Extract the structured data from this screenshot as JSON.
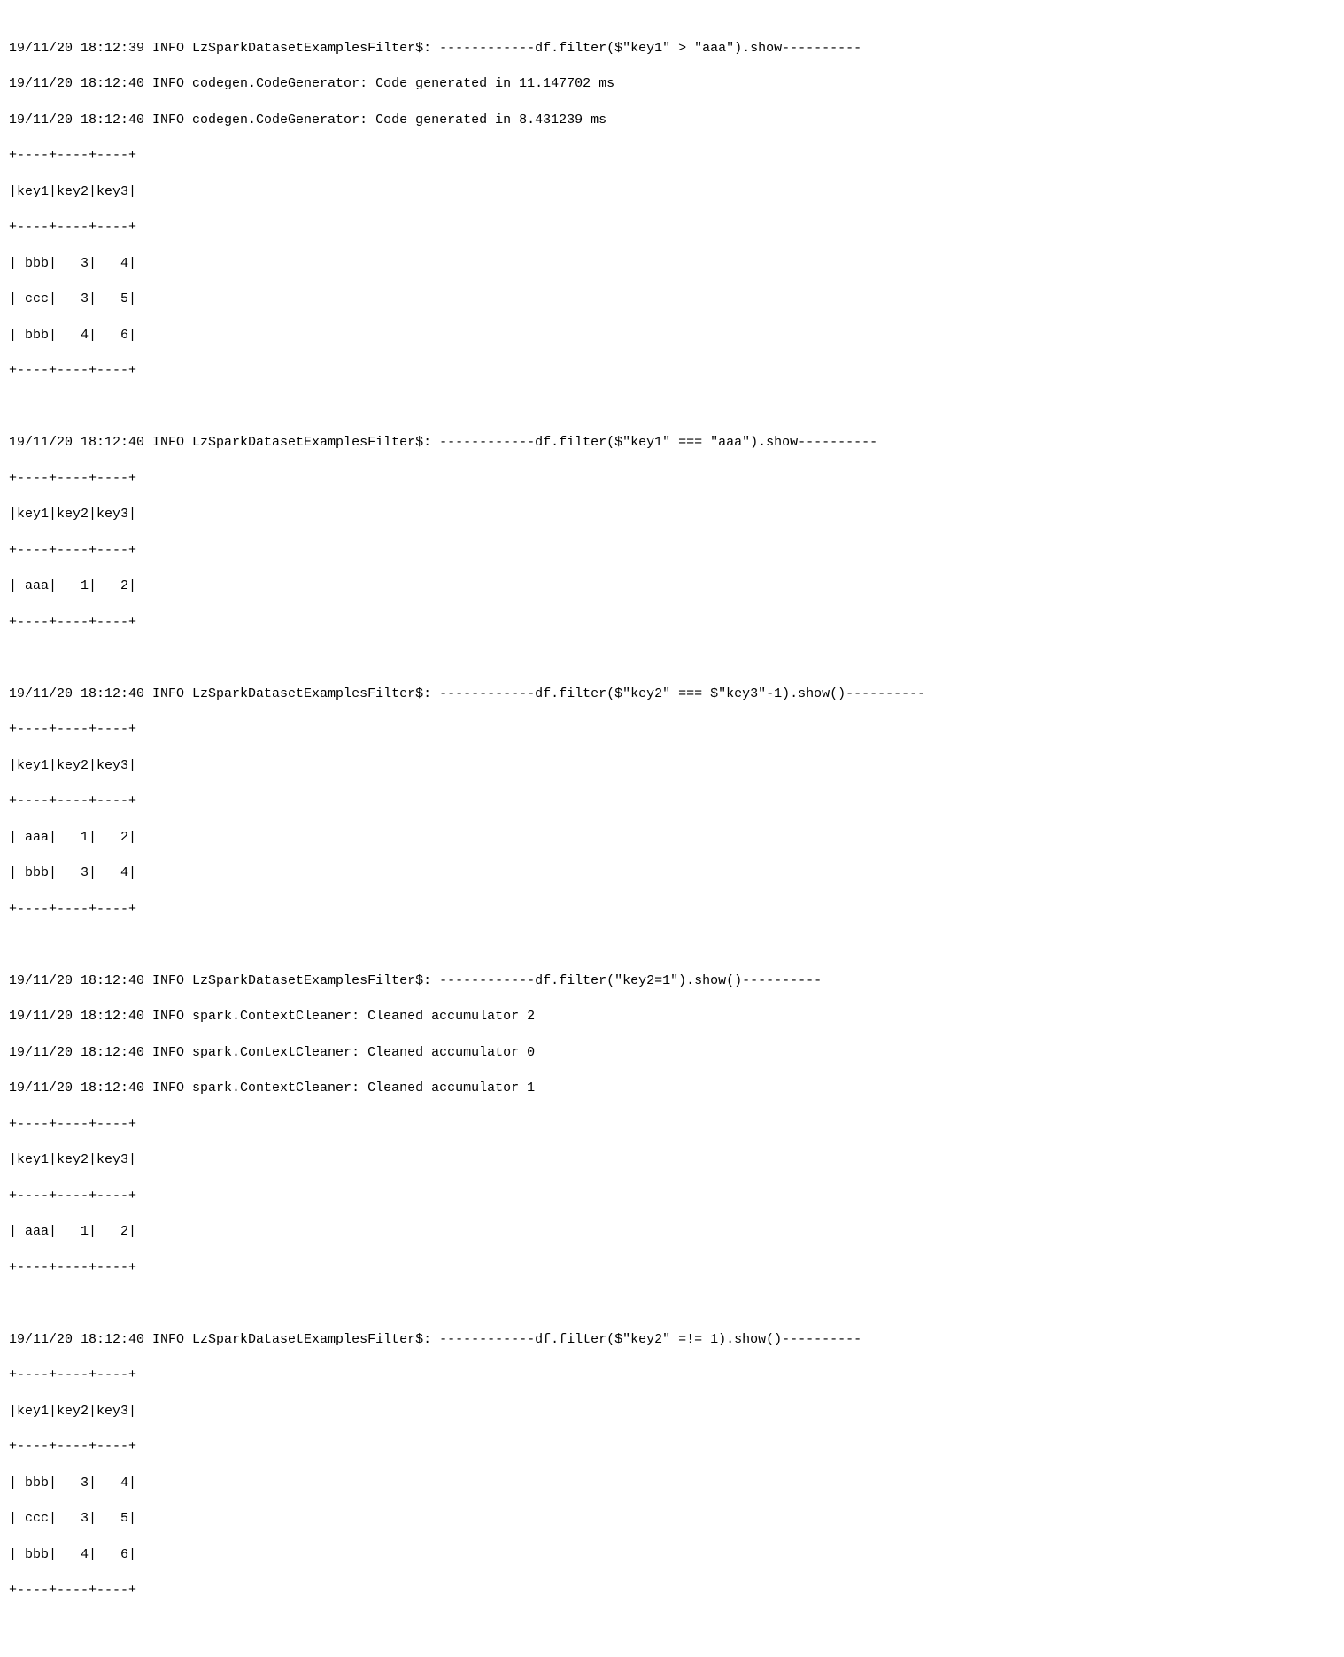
{
  "logs": {
    "l1": "19/11/20 18:12:39 INFO LzSparkDatasetExamplesFilter$: ------------df.filter($\"key1\" > \"aaa\").show----------",
    "l2": "19/11/20 18:12:40 INFO codegen.CodeGenerator: Code generated in 11.147702 ms",
    "l3": "19/11/20 18:12:40 INFO codegen.CodeGenerator: Code generated in 8.431239 ms",
    "l4": "19/11/20 18:12:40 INFO LzSparkDatasetExamplesFilter$: ------------df.filter($\"key1\" === \"aaa\").show----------",
    "l5": "19/11/20 18:12:40 INFO LzSparkDatasetExamplesFilter$: ------------df.filter($\"key2\" === $\"key3\"-1).show()----------",
    "l6": "19/11/20 18:12:40 INFO LzSparkDatasetExamplesFilter$: ------------df.filter(\"key2=1\").show()----------",
    "l7": "19/11/20 18:12:40 INFO spark.ContextCleaner: Cleaned accumulator 2",
    "l8": "19/11/20 18:12:40 INFO spark.ContextCleaner: Cleaned accumulator 0",
    "l9": "19/11/20 18:12:40 INFO spark.ContextCleaner: Cleaned accumulator 1",
    "l10": "19/11/20 18:12:40 INFO LzSparkDatasetExamplesFilter$: ------------df.filter($\"key2\" =!= 1).show()----------"
  },
  "tables": {
    "border": "+----+----+----+",
    "header": "|key1|key2|key3|",
    "t1": {
      "r1": "| bbb|   3|   4|",
      "r2": "| ccc|   3|   5|",
      "r3": "| bbb|   4|   6|"
    },
    "t2": {
      "r1": "| aaa|   1|   2|"
    },
    "t3": {
      "r1": "| aaa|   1|   2|",
      "r2": "| bbb|   3|   4|"
    },
    "t4": {
      "r1": "| aaa|   1|   2|"
    },
    "t5": {
      "r1": "| bbb|   3|   4|",
      "r2": "| ccc|   3|   5|",
      "r3": "| bbb|   4|   6|"
    }
  }
}
